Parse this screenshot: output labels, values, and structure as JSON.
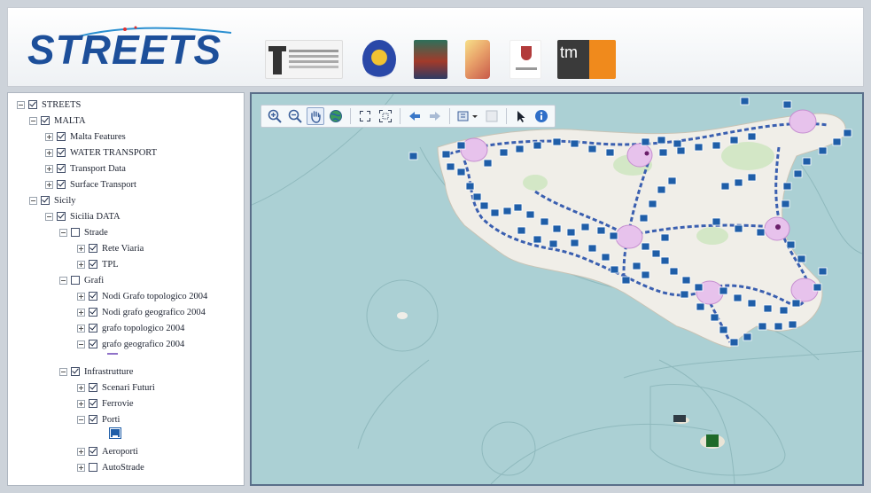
{
  "header": {
    "logo_text": "STREETS",
    "partner_tm_text": "tm"
  },
  "layer_tree": {
    "nodes": [
      {
        "label": "STREETS",
        "checked": true,
        "expander": "minus"
      },
      {
        "label": "MALTA",
        "checked": true,
        "expander": "minus"
      },
      {
        "label": "Malta Features",
        "checked": true,
        "expander": "plus"
      },
      {
        "label": "WATER TRANSPORT",
        "checked": true,
        "expander": "plus"
      },
      {
        "label": "Transport Data",
        "checked": true,
        "expander": "plus"
      },
      {
        "label": "Surface Transport",
        "checked": true,
        "expander": "plus"
      },
      {
        "label": "Sicily",
        "checked": true,
        "expander": "minus"
      },
      {
        "label": "Sicilia DATA",
        "checked": true,
        "expander": "minus"
      },
      {
        "label": "Strade",
        "checked": false,
        "expander": "minus"
      },
      {
        "label": "Rete Viaria",
        "checked": true,
        "expander": "plus"
      },
      {
        "label": "TPL",
        "checked": true,
        "expander": "plus"
      },
      {
        "label": "Grafi",
        "checked": false,
        "expander": "minus"
      },
      {
        "label": "Nodi Grafo topologico 2004",
        "checked": true,
        "expander": "plus"
      },
      {
        "label": "Nodi grafo geografico 2004",
        "checked": true,
        "expander": "plus"
      },
      {
        "label": "grafo topologico 2004",
        "checked": true,
        "expander": "plus"
      },
      {
        "label": "grafo geografico 2004",
        "checked": true,
        "expander": "minus"
      },
      {
        "label": "Infrastrutture",
        "checked": true,
        "expander": "minus"
      },
      {
        "label": "Scenari Futuri",
        "checked": true,
        "expander": "plus"
      },
      {
        "label": "Ferrovie",
        "checked": true,
        "expander": "plus"
      },
      {
        "label": "Porti",
        "checked": true,
        "expander": "minus"
      },
      {
        "label": "Aeroporti",
        "checked": true,
        "expander": "plus"
      },
      {
        "label": "AutoStrade",
        "checked": false,
        "expander": "plus"
      }
    ]
  },
  "map_toolbar": {
    "tools": [
      "zoom-in-icon",
      "zoom-out-icon",
      "pan-hand-icon",
      "globe-icon",
      "zoom-full-icon",
      "zoom-extent-icon",
      "back-arrow-icon",
      "forward-arrow-icon",
      "layer-select-icon",
      "disabled-box-icon",
      "pointer-icon",
      "info-icon"
    ],
    "active_tool": "pan-hand-icon"
  },
  "colors": {
    "sea": "#abd0d4",
    "land": "#f0eee8",
    "marker": "#1f5ea8",
    "node_circle": "#e7c2ec"
  }
}
